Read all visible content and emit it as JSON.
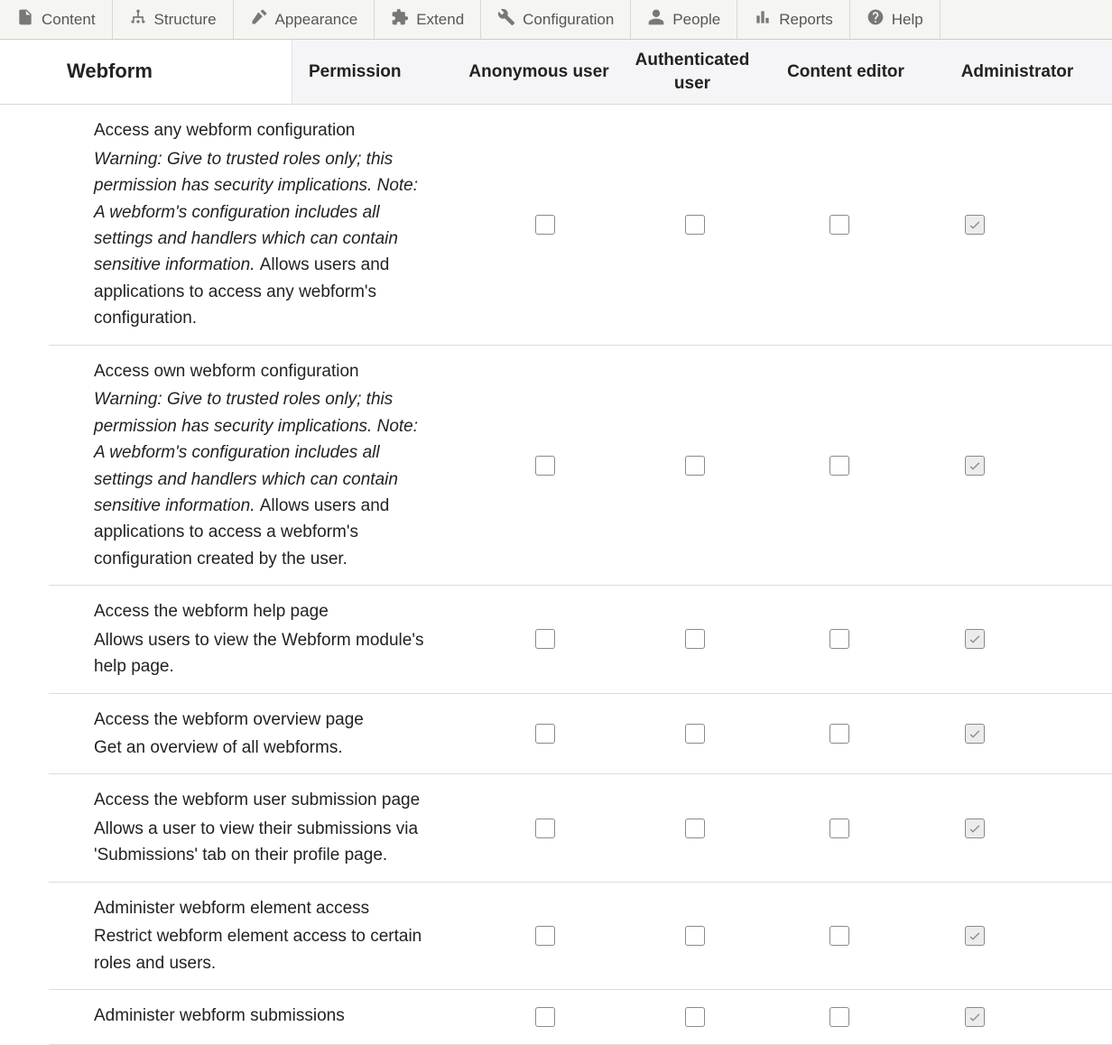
{
  "toolbar": [
    {
      "label": "Content",
      "icon": "file"
    },
    {
      "label": "Structure",
      "icon": "structure"
    },
    {
      "label": "Appearance",
      "icon": "appearance"
    },
    {
      "label": "Extend",
      "icon": "puzzle"
    },
    {
      "label": "Configuration",
      "icon": "wrench"
    },
    {
      "label": "People",
      "icon": "people"
    },
    {
      "label": "Reports",
      "icon": "reports"
    },
    {
      "label": "Help",
      "icon": "help"
    }
  ],
  "section_title": "Webform",
  "columns": {
    "permission": "Permission",
    "roles": [
      "Anonymous user",
      "Authenticated user",
      "Content editor",
      "Administrator"
    ]
  },
  "permissions": [
    {
      "title": "Access any webform configuration",
      "warning": "Warning: Give to trusted roles only; this permission has security implications. Note: A webform's configuration includes all settings and handlers which can contain sensitive information.",
      "desc": "Allows users and applications to access any webform's configuration.",
      "checks": [
        false,
        false,
        false,
        true
      ],
      "admin_locked": true
    },
    {
      "title": "Access own webform configuration",
      "warning": "Warning: Give to trusted roles only; this permission has security implications. Note: A webform's configuration includes all settings and handlers which can contain sensitive information.",
      "desc": "Allows users and applications to access a webform's configuration created by the user.",
      "checks": [
        false,
        false,
        false,
        true
      ],
      "admin_locked": true
    },
    {
      "title": "Access the webform help page",
      "warning": "",
      "desc": "Allows users to view the Webform module's help page.",
      "checks": [
        false,
        false,
        false,
        true
      ],
      "admin_locked": true
    },
    {
      "title": "Access the webform overview page",
      "warning": "",
      "desc": "Get an overview of all webforms.",
      "checks": [
        false,
        false,
        false,
        true
      ],
      "admin_locked": true
    },
    {
      "title": "Access the webform user submission page",
      "warning": "",
      "desc": "Allows a user to view their submissions via 'Submissions' tab on their profile page.",
      "checks": [
        false,
        false,
        false,
        true
      ],
      "admin_locked": true
    },
    {
      "title": "Administer webform element access",
      "warning": "",
      "desc": "Restrict webform element access to certain roles and users.",
      "checks": [
        false,
        false,
        false,
        true
      ],
      "admin_locked": true
    },
    {
      "title": "Administer webform submissions",
      "warning": "",
      "desc": "",
      "checks": [
        false,
        false,
        false,
        true
      ],
      "admin_locked": true
    }
  ]
}
